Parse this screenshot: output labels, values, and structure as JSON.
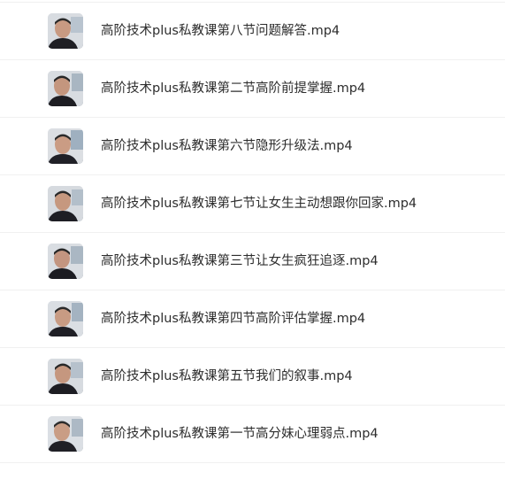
{
  "files": [
    {
      "name": "高阶技术plus私教课第八节问题解答.mp4",
      "thumbnail_icon": "video-thumbnail-icon"
    },
    {
      "name": "高阶技术plus私教课第二节高阶前提掌握.mp4",
      "thumbnail_icon": "video-thumbnail-icon"
    },
    {
      "name": "高阶技术plus私教课第六节隐形升级法.mp4",
      "thumbnail_icon": "video-thumbnail-icon"
    },
    {
      "name": "高阶技术plus私教课第七节让女生主动想跟你回家.mp4",
      "thumbnail_icon": "video-thumbnail-icon"
    },
    {
      "name": "高阶技术plus私教课第三节让女生疯狂追逐.mp4",
      "thumbnail_icon": "video-thumbnail-icon"
    },
    {
      "name": "高阶技术plus私教课第四节高阶评估掌握.mp4",
      "thumbnail_icon": "video-thumbnail-icon"
    },
    {
      "name": "高阶技术plus私教课第五节我们的叙事.mp4",
      "thumbnail_icon": "video-thumbnail-icon"
    },
    {
      "name": "高阶技术plus私教课第一节高分妹心理弱点.mp4",
      "thumbnail_icon": "video-thumbnail-icon"
    }
  ],
  "colors": {
    "text": "#2d2d2d",
    "divider": "#f0f0f0",
    "background": "#ffffff"
  }
}
